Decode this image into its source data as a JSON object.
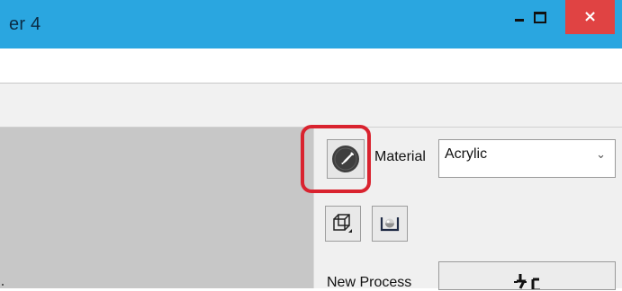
{
  "window": {
    "title": "er 4",
    "min_glyph": "minimize-icon",
    "max_glyph": "maximize-icon",
    "close_glyph": "×"
  },
  "panel": {
    "material_button_icon": "compass-pen-icon",
    "material_label": "Material",
    "material_select_value": "Acrylic",
    "material_select_chevron": "⌄",
    "tool_buttons": [
      {
        "icon": "3d-box-icon"
      },
      {
        "icon": "sphere-view-icon"
      }
    ],
    "new_process_label": "New Process",
    "new_process_icon": "laser-head-icon"
  },
  "colors": {
    "titlebar": "#2aa6e0",
    "close_button": "#e04343",
    "highlight": "#d9232f",
    "canvas": "#c7c7c7",
    "panel": "#f0f0f0"
  }
}
